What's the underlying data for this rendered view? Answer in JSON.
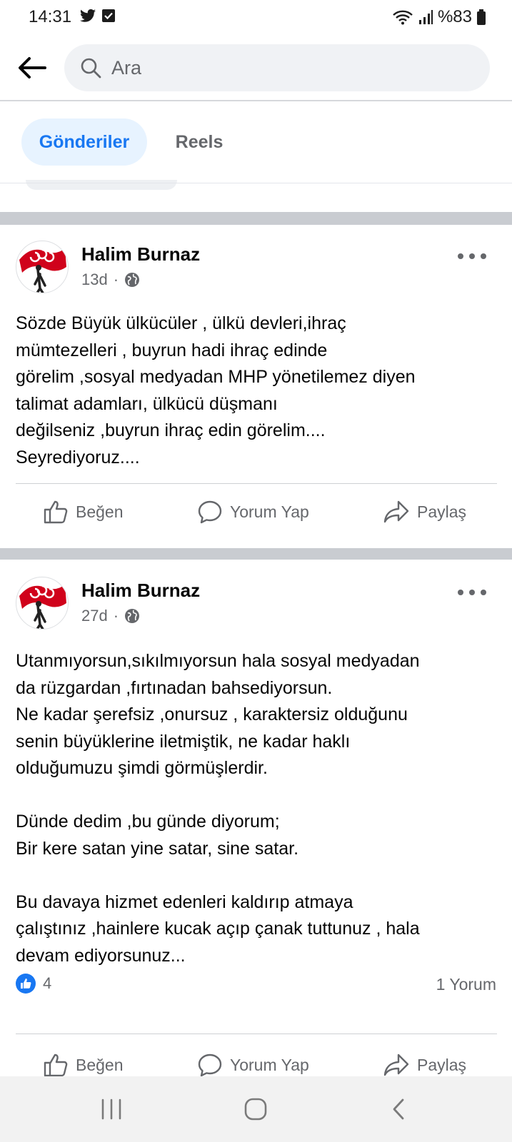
{
  "status_bar": {
    "time": "14:31",
    "battery": "%83"
  },
  "search": {
    "placeholder": "Ara"
  },
  "tabs": [
    {
      "label": "Gönderiler"
    },
    {
      "label": "Reels"
    }
  ],
  "posts": [
    {
      "author": "Halim Burnaz",
      "time": "13d",
      "text": "Sözde Büyük ülkücüler , ülkü devleri,ihraç\nmümtezelleri , buyrun hadi ihraç edinde\ngörelim ,sosyal medyadan MHP yönetilemez diyen\ntalimat adamları, ülkücü düşmanı\ndeğilseniz ,buyrun ihraç edin görelim....\nSeyrediyoruz....",
      "actions": {
        "like": "Beğen",
        "comment": "Yorum Yap",
        "share": "Paylaş"
      }
    },
    {
      "author": "Halim Burnaz",
      "time": "27d",
      "text": "Utanmıyorsun,sıkılmıyorsun hala sosyal medyadan\nda rüzgardan ,fırtınadan bahsediyorsun.\nNe kadar şerefsiz ,onursuz , karaktersiz olduğunu\nsenin büyüklerine iletmiştik, ne kadar haklı\nolduğumuzu şimdi görmüşlerdir.\n\nDünde dedim ,bu günde diyorum;\nBir kere satan yine satar, sine satar.\n\nBu davaya hizmet edenleri kaldırıp atmaya\nçalıştınız ,hainlere kucak açıp çanak tuttunuz , hala\ndevam ediyorsunuz...",
      "reaction_count": "4",
      "comment_count": "1 Yorum",
      "actions": {
        "like": "Beğen",
        "comment": "Yorum Yap",
        "share": "Paylaş"
      }
    }
  ],
  "icons": {
    "accent": "#1877f2",
    "secondary_text": "#65676b",
    "avatar_red": "#d0021b"
  }
}
